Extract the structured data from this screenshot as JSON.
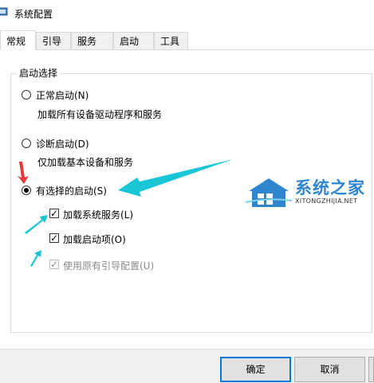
{
  "window": {
    "title": "系统配置"
  },
  "tabs": [
    "常规",
    "引导",
    "服务",
    "启动",
    "工具"
  ],
  "startup_group": {
    "label": "启动选择",
    "normal": {
      "label": "正常启动(N)",
      "desc": "加载所有设备驱动程序和服务",
      "checked": false
    },
    "diagnostic": {
      "label": "诊断启动(D)",
      "desc": "仅加载基本设备和服务",
      "checked": false
    },
    "selective": {
      "label": "有选择的启动(S)",
      "checked": true,
      "options": [
        {
          "label": "加载系统服务(L)",
          "checked": true,
          "enabled": true
        },
        {
          "label": "加载启动项(O)",
          "checked": true,
          "enabled": true
        },
        {
          "label": "使用原有引导配置(U)",
          "checked": true,
          "enabled": false
        }
      ]
    }
  },
  "buttons": {
    "ok": "确定",
    "cancel": "取消"
  },
  "watermark": {
    "cn": "系统之家",
    "en": "XITONGZHIJIA.NET"
  },
  "colors": {
    "arrow_cyan": "#19c6d6",
    "arrow_red": "#e53935",
    "accent": "#0078d7"
  }
}
